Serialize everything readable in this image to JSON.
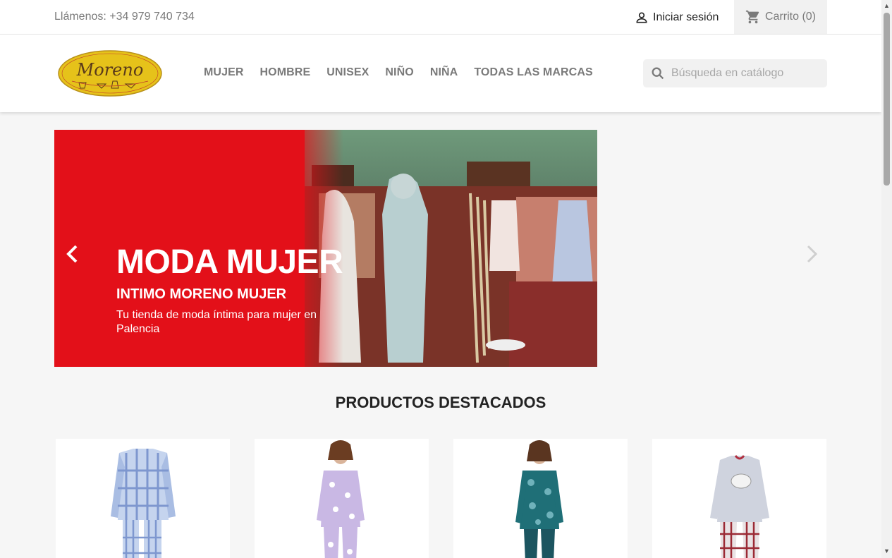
{
  "topbar": {
    "phone": "Llámenos: +34 979 740 734",
    "signin_label": "Iniciar sesión",
    "cart_label": "Carrito (0)"
  },
  "header": {
    "logo_text": "Moreno",
    "nav": [
      "MUJER",
      "HOMBRE",
      "UNISEX",
      "NIÑO",
      "NIÑA",
      "TODAS LAS MARCAS"
    ],
    "search_placeholder": "Búsqueda en catálogo"
  },
  "slider": {
    "title": "MODA MUJER",
    "subtitle": "INTIMO MORENO MUJER",
    "text": "Tu tienda de moda íntima para mujer en Palencia"
  },
  "featured": {
    "title": "PRODUCTOS DESTACADOS"
  },
  "colors": {
    "accent_red": "#e31019",
    "logo_yellow": "#e6c21a"
  }
}
